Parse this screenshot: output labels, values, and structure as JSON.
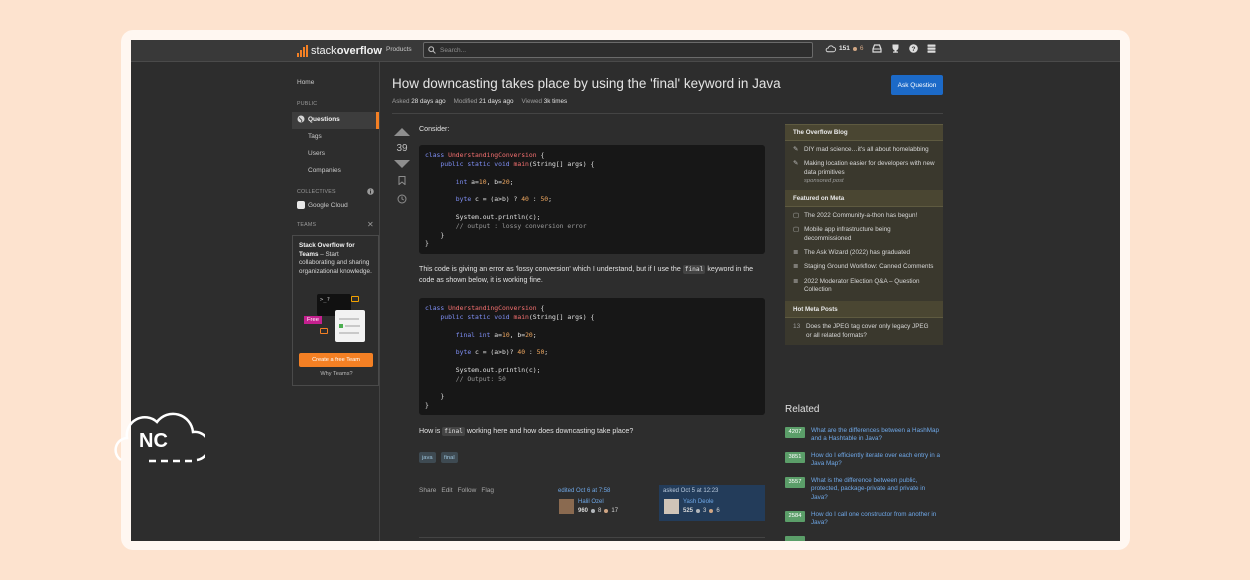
{
  "topbar": {
    "logo_light": "stack",
    "logo_bold": "overflow",
    "products": "Products",
    "search_placeholder": "Search...",
    "reputation": "151",
    "bronze": "6",
    "colors": {
      "accent": "#f48024",
      "bronze": "#d1a684",
      "link": "#6fa8e8"
    }
  },
  "leftnav": {
    "home": "Home",
    "public": "PUBLIC",
    "questions": "Questions",
    "tags": "Tags",
    "users": "Users",
    "companies": "Companies",
    "collectives": "COLLECTIVES",
    "google_cloud": "Google Cloud",
    "teams": "TEAMS",
    "teams_title": "Stack Overflow for Teams",
    "teams_desc": " – Start collaborating and sharing organizational knowledge.",
    "free": "Free",
    "create_team": "Create a free Team",
    "why_teams": "Why Teams?"
  },
  "question": {
    "title": "How downcasting takes place by using the 'final' keyword in Java",
    "asked_label": "Asked",
    "asked": "28 days ago",
    "modified_label": "Modified",
    "modified": "21 days ago",
    "viewed_label": "Viewed",
    "viewed": "3k times",
    "ask_button": "Ask Question",
    "votes": "39",
    "consider": "Consider:",
    "para1_a": "This code is giving an error as 'lossy conversion' which I understand, but if I use the ",
    "para1_code": "final",
    "para1_b": " keyword in the code as shown below, it is working fine.",
    "para2_a": "How is ",
    "para2_code": "final",
    "para2_b": " working here and how does downcasting take place?",
    "tags": [
      "java",
      "final"
    ],
    "menu": [
      "Share",
      "Edit",
      "Follow",
      "Flag"
    ],
    "edited": "edited Oct 6 at 7:58",
    "editor_name": "Halil Ozel",
    "editor_rep": "960",
    "editor_silver": "8",
    "editor_bronze": "17",
    "asked_sig": "asked Oct 5 at 12:23",
    "asker_name": "Yash Deole",
    "asker_rep": "525",
    "asker_silver": "3",
    "asker_bronze": "6"
  },
  "code1": {
    "l1_kw": "class",
    "l1_name": "UnderstandingConversion",
    "l1_end": " {",
    "l2_kw": "public static void",
    "l2_fn": "main",
    "l2_end": "(String[] args) {",
    "l3_kw": "int",
    "l3_a": " a=",
    "l3_n1": "10",
    "l3_b": ", b=",
    "l3_n2": "20",
    "l3_end": ";",
    "l4_kw": "byte",
    "l4_a": " c = (a>b) ? ",
    "l4_n1": "40",
    "l4_b": " : ",
    "l4_n2": "50",
    "l4_end": ";",
    "l5": "System.out.println(c);",
    "l6": "// output : lossy conversion error",
    "l7": "}",
    "l8": "}"
  },
  "code2": {
    "l1_kw": "class",
    "l1_name": "UnderstandingConversion",
    "l1_end": " {",
    "l2_kw": "public static void",
    "l2_fn": "main",
    "l2_end": "(String[] args) {",
    "l3_kw": "final int",
    "l3_a": " a=",
    "l3_n1": "10",
    "l3_b": ", b=",
    "l3_n2": "20",
    "l3_end": ";",
    "l4_kw": "byte",
    "l4_a": " c = (a>b)? ",
    "l4_n1": "40",
    "l4_b": " : ",
    "l4_n2": "50",
    "l4_end": ";",
    "l5": "System.out.println(c);",
    "l6": "// Output: 50",
    "l7": "}",
    "l8": "}"
  },
  "sidebar": {
    "blog_title": "The Overflow Blog",
    "blog": [
      "DIY mad science…it's all about homelabbing",
      "Making location easier for developers with new data primitives"
    ],
    "sponsored": "sponsored post",
    "meta_title": "Featured on Meta",
    "meta": [
      "The 2022 Community-a-thon has begun!",
      "Mobile app infrastructure being decommissioned",
      "The Ask Wizard (2022) has graduated",
      "Staging Ground Workflow: Canned Comments",
      "2022 Moderator Election Q&A – Question Collection"
    ],
    "hot_title": "Hot Meta Posts",
    "hot_count": "13",
    "hot": "Does the JPEG tag cover only legacy JPEG or all related formats?"
  },
  "related": {
    "title": "Related",
    "items": [
      {
        "count": "4207",
        "text": "What are the differences between a HashMap and a Hashtable in Java?"
      },
      {
        "count": "3851",
        "text": "How do I efficiently iterate over each entry in a Java Map?"
      },
      {
        "count": "3557",
        "text": "What is the difference between public, protected, package-private and private in Java?"
      },
      {
        "count": "2584",
        "text": "How do I call one constructor from another in Java?"
      }
    ]
  },
  "watermark": "NC"
}
